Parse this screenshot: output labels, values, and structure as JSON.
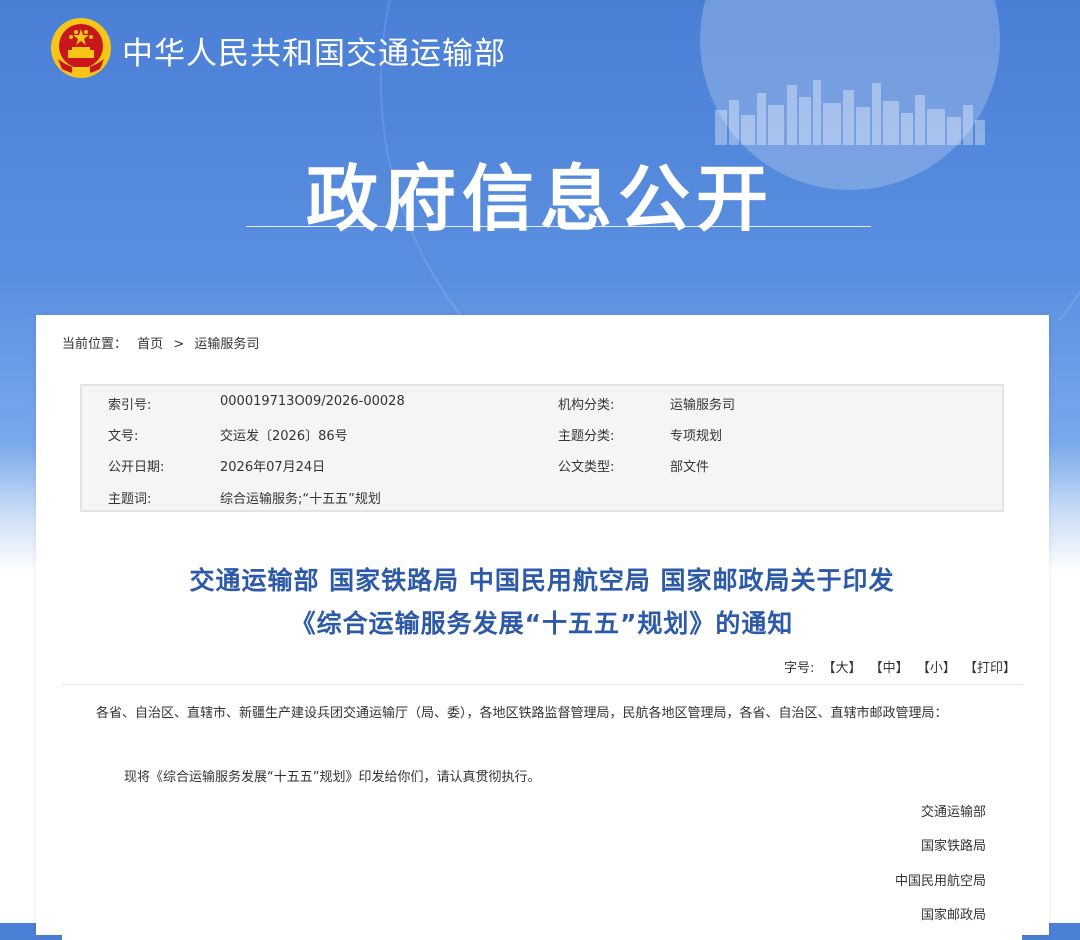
{
  "header": {
    "ministry_name": "中华人民共和国交通运输部",
    "hero_title": "政府信息公开"
  },
  "breadcrumb": {
    "label": "当前位置：",
    "home": "首页",
    "separator": ">",
    "current": "运输服务司"
  },
  "meta": [
    {
      "k1": "索引号:",
      "v1": "000019713O09/2026-00028",
      "k2": "机构分类:",
      "v2": "运输服务司"
    },
    {
      "k1": "文号:",
      "v1": "交运发〔2026〕86号",
      "k2": "主题分类:",
      "v2": "专项规划"
    },
    {
      "k1": "公开日期:",
      "v1": "2026年07月24日",
      "k2": "公文类型:",
      "v2": "部文件"
    },
    {
      "k1": "主题词:",
      "v1": "综合运输服务;“十五五”规划",
      "k2": "",
      "v2": ""
    }
  ],
  "document": {
    "title_line1": "交通运输部 国家铁路局 中国民用航空局 国家邮政局关于印发",
    "title_line2": "《综合运输服务发展“十五五”规划》的通知",
    "font_size_label": "字号:",
    "font_large": "【大】",
    "font_medium": "【中】",
    "font_small": "【小】",
    "print": "【打印】",
    "recipients": "各省、自治区、直辖市、新疆生产建设兵团交通运输厅（局、委），各地区铁路监督管理局，民航各地区管理局，各省、自治区、直辖市邮政管理局：",
    "paragraph": "现将《综合运输服务发展“十五五”规划》印发给你们，请认真贯彻执行。",
    "signatories": [
      "交通运输部",
      "国家铁路局",
      "中国民用航空局",
      "国家邮政局"
    ]
  },
  "colors": {
    "banner_blue": "#4a7fd6",
    "title_blue": "#2d5aa8",
    "emblem_red": "#c8161d",
    "emblem_gold": "#f5c518"
  }
}
